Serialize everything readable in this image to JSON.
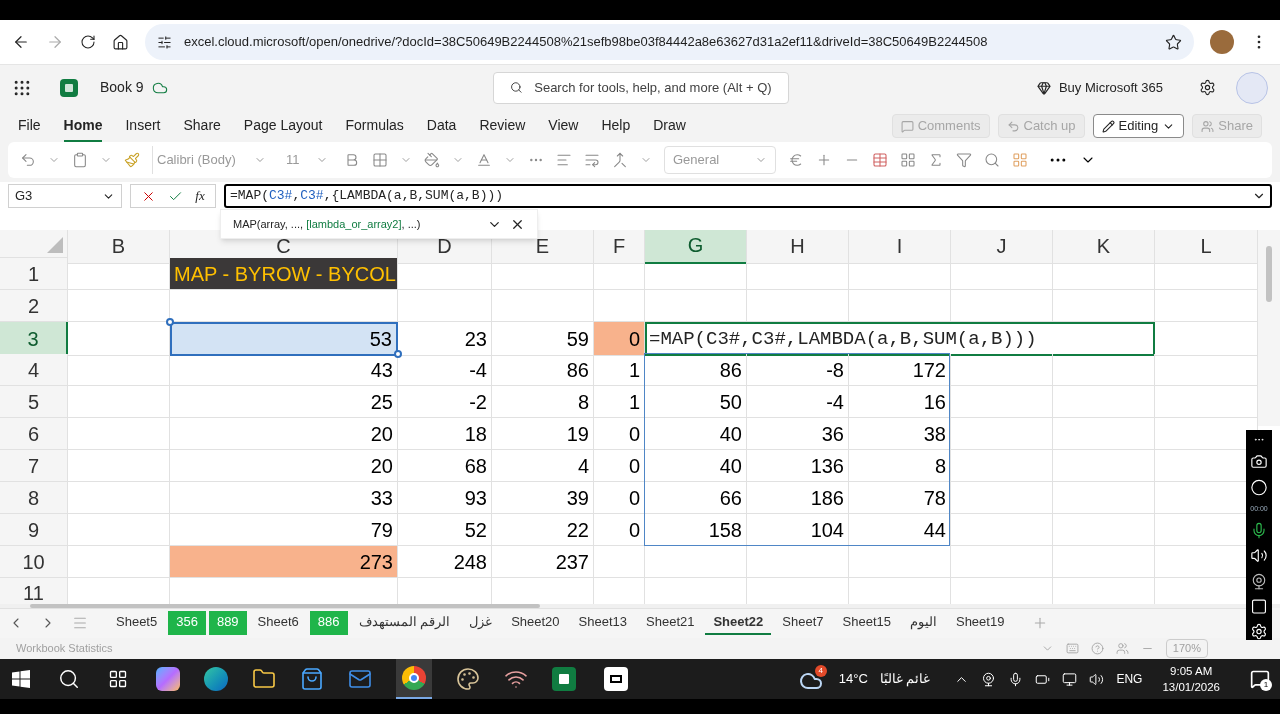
{
  "browser": {
    "url": "excel.cloud.microsoft/open/onedrive/?docId=38C50649B2244508%21sefb98be03f84442a8e63627d31a2ef11&driveId=38C50649B2244508"
  },
  "app": {
    "title": "Book 9",
    "search": {
      "placeholder": "Search for tools, help, and more (Alt + Q)"
    },
    "buy": "Buy Microsoft 365"
  },
  "menu": [
    {
      "label": "File",
      "selected": false
    },
    {
      "label": "Home",
      "selected": true
    },
    {
      "label": "Insert",
      "selected": false
    },
    {
      "label": "Share",
      "selected": false
    },
    {
      "label": "Page Layout",
      "selected": false
    },
    {
      "label": "Formulas",
      "selected": false
    },
    {
      "label": "Data",
      "selected": false
    },
    {
      "label": "Review",
      "selected": false
    },
    {
      "label": "View",
      "selected": false
    },
    {
      "label": "Help",
      "selected": false
    },
    {
      "label": "Draw",
      "selected": false
    }
  ],
  "ribbon_actions": [
    {
      "label": "Comments",
      "disabled": true
    },
    {
      "label": "Catch up",
      "disabled": true
    },
    {
      "label": "Editing",
      "disabled": false
    },
    {
      "label": "Share",
      "disabled": true
    }
  ],
  "toolbar": {
    "font": "Calibri (Body)",
    "size": "11",
    "number_format": "General"
  },
  "formula_bar": {
    "name_box": "G3",
    "function_label": "fx",
    "formula": [
      {
        "text": "=MAP(",
        "kind": "plain"
      },
      {
        "text": "C3#",
        "kind": "ref"
      },
      {
        "text": ",",
        "kind": "plain"
      },
      {
        "text": "C3#",
        "kind": "ref"
      },
      {
        "text": ",{LAMBDA(a,B,SUM(a,B)))",
        "kind": "plain"
      }
    ]
  },
  "tooltip": [
    {
      "text": "MAP(array, ..., ",
      "kind": "plain"
    },
    {
      "text": "[lambda_or_array2]",
      "kind": "current"
    },
    {
      "text": ", ...)",
      "kind": "plain"
    }
  ],
  "columns": [
    {
      "label": "B",
      "selected": false
    },
    {
      "label": "C",
      "selected": false
    },
    {
      "label": "D",
      "selected": false
    },
    {
      "label": "E",
      "selected": false
    },
    {
      "label": "F",
      "selected": false
    },
    {
      "label": "G",
      "selected": true
    },
    {
      "label": "H",
      "selected": false
    },
    {
      "label": "I",
      "selected": false
    },
    {
      "label": "J",
      "selected": false
    },
    {
      "label": "K",
      "selected": false
    },
    {
      "label": "L",
      "selected": false
    }
  ],
  "rows": [
    {
      "label": "1",
      "selected": false,
      "cells": {
        "c": {
          "text": "MAP - BYROW - BYCOL",
          "kind": "title",
          "color": "#3b3838"
        }
      }
    },
    {
      "label": "2",
      "selected": false,
      "cells": {}
    },
    {
      "label": "3",
      "selected": true,
      "cells": {
        "c": {
          "text": "53",
          "selected": true
        },
        "d": {
          "text": "23"
        },
        "e": {
          "text": "59"
        },
        "f": {
          "text": "0",
          "color": "#f8b28c"
        },
        "g": {
          "text": "=MAP(C3#,C3#,LAMBDA(a,B,SUM(a,B)))",
          "kind": "editing"
        }
      }
    },
    {
      "label": "4",
      "selected": false,
      "cells": {
        "c": {
          "text": "43"
        },
        "d": {
          "text": "-4"
        },
        "e": {
          "text": "86"
        },
        "f": {
          "text": "1"
        },
        "g": {
          "text": "86"
        },
        "h": {
          "text": "-8"
        },
        "i": {
          "text": "172"
        }
      }
    },
    {
      "label": "5",
      "selected": false,
      "cells": {
        "c": {
          "text": "25"
        },
        "d": {
          "text": "-2"
        },
        "e": {
          "text": "8"
        },
        "f": {
          "text": "1"
        },
        "g": {
          "text": "50"
        },
        "h": {
          "text": "-4"
        },
        "i": {
          "text": "16"
        }
      }
    },
    {
      "label": "6",
      "selected": false,
      "cells": {
        "c": {
          "text": "20"
        },
        "d": {
          "text": "18"
        },
        "e": {
          "text": "19"
        },
        "f": {
          "text": "0"
        },
        "g": {
          "text": "40"
        },
        "h": {
          "text": "36"
        },
        "i": {
          "text": "38"
        }
      }
    },
    {
      "label": "7",
      "selected": false,
      "cells": {
        "c": {
          "text": "20"
        },
        "d": {
          "text": "68"
        },
        "e": {
          "text": "4"
        },
        "f": {
          "text": "0"
        },
        "g": {
          "text": "40"
        },
        "h": {
          "text": "136"
        },
        "i": {
          "text": "8"
        }
      }
    },
    {
      "label": "8",
      "selected": false,
      "cells": {
        "c": {
          "text": "33"
        },
        "d": {
          "text": "93"
        },
        "e": {
          "text": "39"
        },
        "f": {
          "text": "0"
        },
        "g": {
          "text": "66"
        },
        "h": {
          "text": "186"
        },
        "i": {
          "text": "78"
        }
      }
    },
    {
      "label": "9",
      "selected": false,
      "cells": {
        "c": {
          "text": "79"
        },
        "d": {
          "text": "52"
        },
        "e": {
          "text": "22"
        },
        "f": {
          "text": "0"
        },
        "g": {
          "text": "158"
        },
        "h": {
          "text": "104"
        },
        "i": {
          "text": "44"
        }
      }
    },
    {
      "label": "10",
      "selected": false,
      "cells": {
        "c": {
          "text": "273",
          "color": "#f8b28c"
        },
        "d": {
          "text": "248"
        },
        "e": {
          "text": "237"
        }
      }
    },
    {
      "label": "11",
      "selected": false,
      "cells": {}
    }
  ],
  "sheet_tabs": [
    {
      "label": "Sheet5",
      "selected": false
    },
    {
      "label": "356",
      "selected": false,
      "color": "#1fb54a"
    },
    {
      "label": "889",
      "selected": false,
      "color": "#1fb54a"
    },
    {
      "label": "Sheet6",
      "selected": false
    },
    {
      "label": "886",
      "selected": false,
      "color": "#1fb54a"
    },
    {
      "label": "الرقم المستهدف",
      "selected": false
    },
    {
      "label": "غزل",
      "selected": false
    },
    {
      "label": "Sheet20",
      "selected": false
    },
    {
      "label": "Sheet13",
      "selected": false
    },
    {
      "label": "Sheet21",
      "selected": false
    },
    {
      "label": "Sheet22",
      "selected": true
    },
    {
      "label": "Sheet7",
      "selected": false
    },
    {
      "label": "Sheet15",
      "selected": false
    },
    {
      "label": "اليوم",
      "selected": false
    },
    {
      "label": "Sheet19",
      "selected": false
    }
  ],
  "status_bar": {
    "text": "Workbook Statistics",
    "zoom": "170%"
  },
  "recorder": {
    "timer": "00:00"
  },
  "taskbar": {
    "weather_badge": "4",
    "temperature": "14°C",
    "weather": "غائم غالبًا",
    "language": "ENG",
    "time": "9:05 AM",
    "date": "13/01/2026",
    "notifications": "1"
  }
}
